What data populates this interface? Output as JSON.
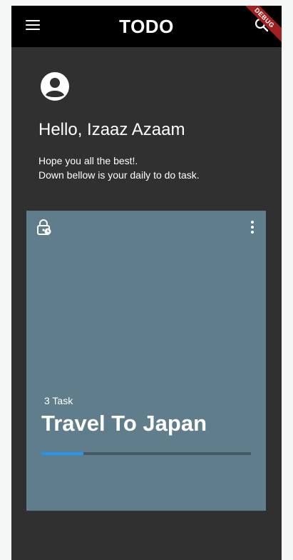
{
  "app": {
    "title": "TODO",
    "debug_label": "DEBUG"
  },
  "header": {
    "greeting": "Hello, Izaaz Azaam",
    "subtitle_line1": "Hope you all the best!.",
    "subtitle_line2": "Down bellow is your daily to do task."
  },
  "card": {
    "task_count": "3 Task",
    "title": "Travel To Japan",
    "progress": 0.2,
    "color": "#607d8b",
    "progress_color": "#2196f3"
  },
  "icons": {
    "menu": "menu-icon",
    "search": "search-icon",
    "avatar": "account-circle-icon",
    "lock": "lock-clock-icon",
    "more": "more-vert-icon"
  }
}
